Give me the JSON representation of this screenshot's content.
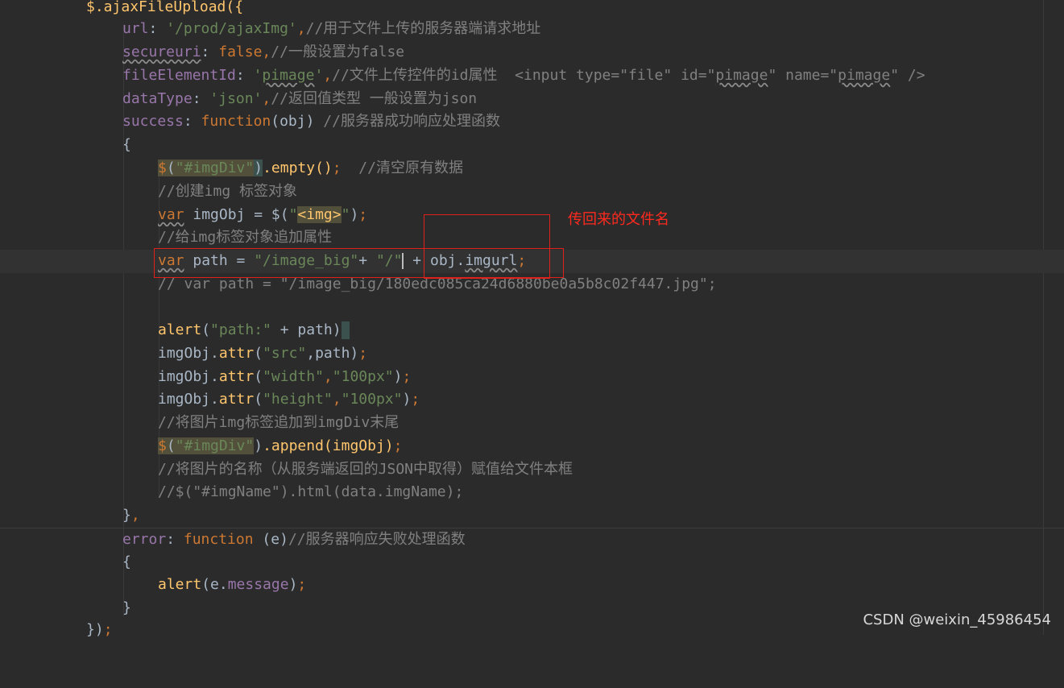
{
  "code": {
    "l1": [
      "$",
      ".ajaxFileUpload({"
    ],
    "l2": [
      "url",
      ": ",
      "'/prod/ajaxImg'",
      ",",
      "//用于文件上传的服务器端请求地址"
    ],
    "l3": [
      "secureuri",
      ": ",
      "false",
      ",",
      "//一般设置为false"
    ],
    "l4": [
      "fileElementId",
      ": ",
      "'",
      "pimage",
      "'",
      ",",
      "//文件上传控件的id属性  <input type=\"file\" id=\"",
      "pimage",
      "\" name=\"",
      "pimage",
      "\" />"
    ],
    "l5": [
      "dataType",
      ": ",
      "'json'",
      ",",
      "//返回值类型 一般设置为json"
    ],
    "l6": [
      "success",
      ": ",
      "function",
      "(obj) ",
      "//服务器成功响应处理函数"
    ],
    "l7": [
      "{"
    ],
    "l8": [
      "$",
      "(",
      "\"#imgDiv\"",
      ")",
      ".empty()",
      ";",
      "  //清空原有数据"
    ],
    "l9": [
      "//创建img 标签对象"
    ],
    "l10": [
      "var",
      " imgObj = $(",
      "\"",
      "<img>",
      "\"",
      ")",
      ";"
    ],
    "l11": [
      "//给img标签对象追加属性"
    ],
    "l12": [
      "var",
      " path = ",
      "\"/image_big\"",
      "+ ",
      "\"/\"",
      " + obj.",
      "imgurl",
      ";"
    ],
    "l13": [
      "// var path = \"/image_big/180edc085ca24d6880be0a5b8c02f447.jpg\";"
    ],
    "l15": [
      "alert",
      "(",
      "\"path:\"",
      " + path)"
    ],
    "l16": [
      "imgObj.",
      "attr",
      "(",
      "\"src\"",
      ",path)",
      ";"
    ],
    "l17": [
      "imgObj.",
      "attr",
      "(",
      "\"width\"",
      ",",
      "\"100px\"",
      ")",
      ";"
    ],
    "l18": [
      "imgObj.",
      "attr",
      "(",
      "\"height\"",
      ",",
      "\"100px\"",
      ")",
      ";"
    ],
    "l19": [
      "//将图片img标签追加到imgDiv末尾"
    ],
    "l20": [
      "$",
      "(",
      "\"#imgDiv\"",
      ")",
      ".append(imgObj)",
      ";"
    ],
    "l21": [
      "//将图片的名称（从服务端返回的JSON中取得）赋值给文件本框"
    ],
    "l22": [
      "//$(\"#imgName\").html(data.imgName);"
    ],
    "l23": [
      "}",
      ","
    ],
    "l24": [
      "error",
      ": ",
      "function",
      " (e)",
      "//服务器响应失败处理函数"
    ],
    "l25": [
      "{"
    ],
    "l26": [
      "alert",
      "(e.",
      "message",
      ")",
      ";"
    ],
    "l27": [
      "}"
    ],
    "l28": [
      "})",
      ";"
    ]
  },
  "annotation": {
    "text": "传回来的文件名",
    "color": "#e0201b"
  },
  "watermark": "CSDN @weixin_45986454",
  "colors": {
    "background": "#2b2b2b",
    "keyword": "#cc7832",
    "string": "#6a8759",
    "comment": "#808080",
    "property": "#9876aa",
    "function": "#ffc66d"
  }
}
